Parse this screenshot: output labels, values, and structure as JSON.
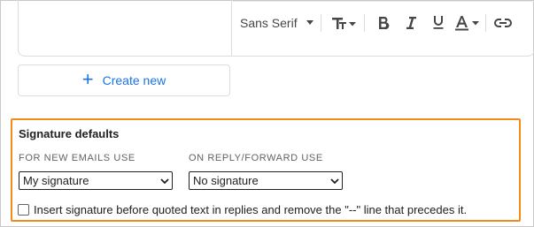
{
  "editor": {
    "font_family": "Sans Serif",
    "toolbar_icons": [
      "text-size-icon",
      "bold-icon",
      "italic-icon",
      "underline-icon",
      "text-color-icon",
      "link-icon"
    ]
  },
  "create_new": {
    "label": "Create new",
    "icon": "plus-icon",
    "color": "#1a73e8"
  },
  "signature_defaults": {
    "title": "Signature defaults",
    "new_emails_label": "FOR NEW EMAILS USE",
    "new_emails_value": "My signature",
    "reply_label": "ON REPLY/FORWARD USE",
    "reply_value": "No signature",
    "checkbox_label": "Insert signature before quoted text in replies and remove the \"--\" line that precedes it.",
    "checkbox_checked": false,
    "highlight_color": "#f08c1a"
  }
}
